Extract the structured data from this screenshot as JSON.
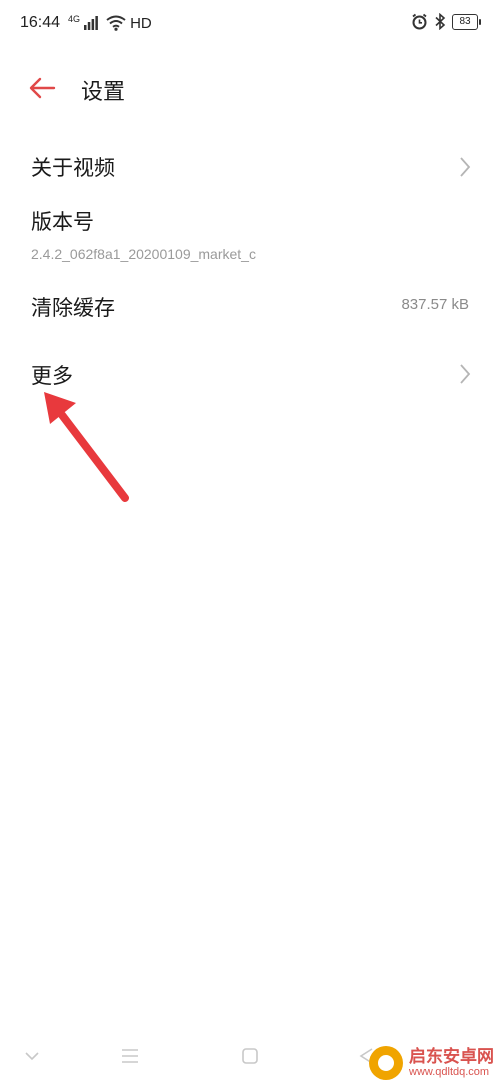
{
  "status_bar": {
    "time": "16:44",
    "network": "4G",
    "hd": "HD",
    "battery": "83"
  },
  "header": {
    "title": "设置"
  },
  "settings": {
    "about_video": "关于视频",
    "version_label": "版本号",
    "version_value": "2.4.2_062f8a1_20200109_market_c",
    "clear_cache_label": "清除缓存",
    "cache_size": "837.57 kB",
    "more_label": "更多"
  },
  "watermark": {
    "name": "启东安卓网",
    "url": "www.qdltdq.com"
  },
  "colors": {
    "accent": "#e04848",
    "annotation_arrow": "#e8393d",
    "text_primary": "#1a1a1a",
    "text_secondary": "#9a9a9a"
  },
  "icons": [
    "signal-icon",
    "wifi-icon",
    "alarm-icon",
    "bluetooth-icon",
    "battery-icon",
    "back-arrow-icon",
    "chevron-right-icon",
    "nav-down-icon",
    "nav-menu-icon",
    "nav-home-icon",
    "nav-back-icon"
  ]
}
